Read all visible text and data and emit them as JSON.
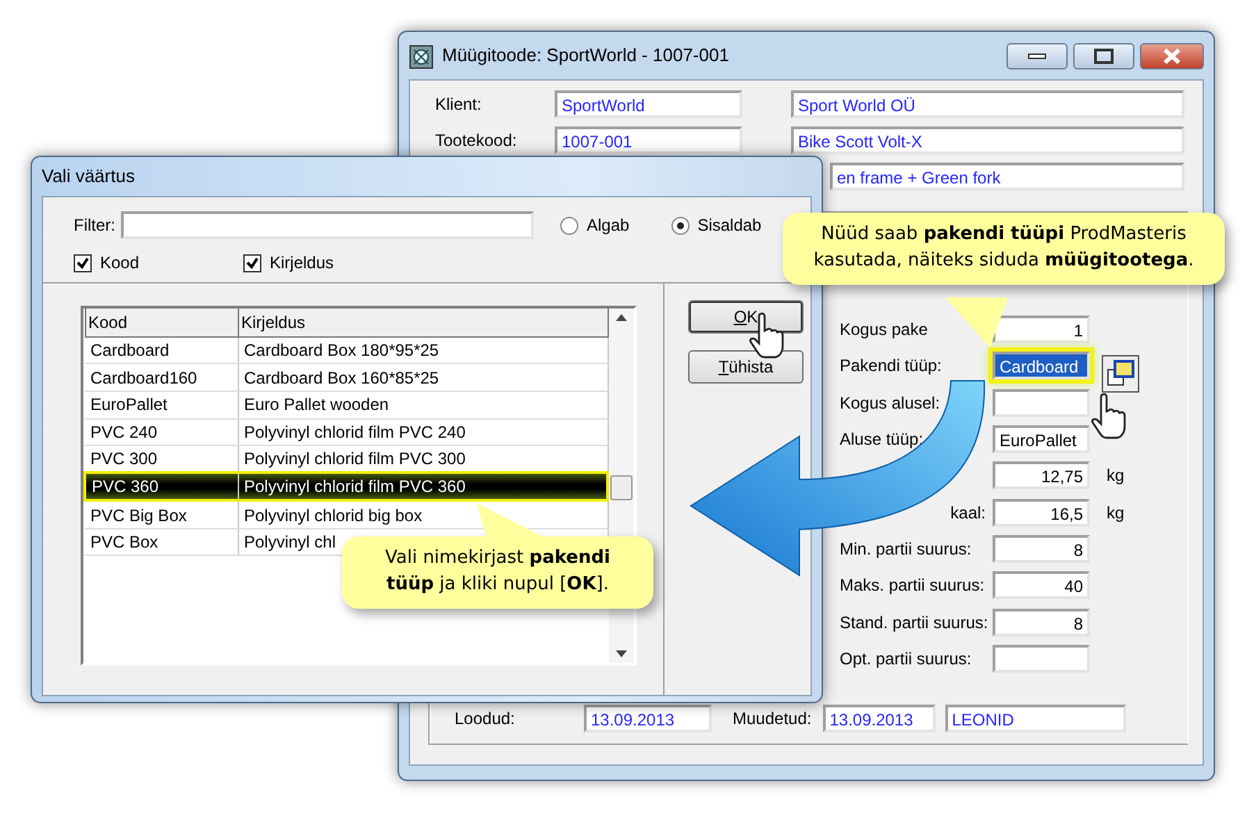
{
  "main_window": {
    "title": "Müügitoode: SportWorld - 1007-001",
    "header_rows": [
      {
        "label": "Klient:",
        "code": "SportWorld",
        "name": "Sport World OÜ"
      },
      {
        "label": "Tootekood:",
        "code": "1007-001",
        "name": "Bike Scott Volt-X"
      },
      {
        "name": "en frame + Green fork"
      }
    ],
    "fields": [
      {
        "label": "Kogus pake",
        "value": "1",
        "kind": "number"
      },
      {
        "label": "Pakendi tüüp:",
        "value": "Cardboard",
        "kind": "picker",
        "highlighted": true
      },
      {
        "label": "Kogus alusel:",
        "kind": "number"
      },
      {
        "label": "Aluse tüüp:",
        "value": "EuroPallet",
        "kind": "text"
      },
      {
        "value": "12,75",
        "unit": "kg",
        "kind": "number"
      },
      {
        "label": "kaal:",
        "value": "16,5",
        "unit": "kg",
        "kind": "number"
      },
      {
        "label": "Min. partii suurus:",
        "value": "8",
        "kind": "number"
      },
      {
        "label": "Maks. partii suurus:",
        "value": "40",
        "kind": "number"
      },
      {
        "label": "Stand. partii suurus:",
        "value": "8",
        "kind": "number"
      },
      {
        "label": "Opt. partii suurus:",
        "kind": "number"
      }
    ],
    "footer": {
      "created_label": "Loodud:",
      "created": "13.09.2013",
      "modified_label": "Muudetud:",
      "modified": "13.09.2013",
      "user": "LEONID"
    }
  },
  "dialog": {
    "title": "Vali väärtus",
    "filter": {
      "label": "Filter:"
    },
    "match_modes": [
      {
        "label": "Algab",
        "selected": false
      },
      {
        "label": "Sisaldab",
        "selected": true
      }
    ],
    "search_in": [
      {
        "label": "Kood",
        "checked": true
      },
      {
        "label": "Kirjeldus",
        "checked": true
      }
    ],
    "table": {
      "columns": [
        "Kood",
        "Kirjeldus"
      ],
      "rows": [
        {
          "cells": [
            "Cardboard",
            "Cardboard Box 180*95*25"
          ],
          "selected": false
        },
        {
          "cells": [
            "Cardboard160",
            "Cardboard Box 160*85*25"
          ],
          "selected": false
        },
        {
          "cells": [
            "EuroPallet",
            "Euro Pallet wooden"
          ],
          "selected": false
        },
        {
          "cells": [
            "PVC 240",
            "Polyvinyl chlorid film PVC 240"
          ],
          "selected": false
        },
        {
          "cells": [
            "PVC 300",
            "Polyvinyl chlorid film PVC 300"
          ],
          "selected": false
        },
        {
          "cells": [
            "PVC 360",
            "Polyvinyl chlorid film PVC 360"
          ],
          "selected": true
        },
        {
          "cells": [
            "PVC Big Box",
            "Polyvinyl chlorid big box"
          ],
          "selected": false
        },
        {
          "cells": [
            "PVC Box",
            "Polyvinyl chl"
          ],
          "selected": false
        }
      ]
    },
    "buttons": [
      {
        "label": "OK"
      },
      {
        "label": "Tühista"
      }
    ]
  },
  "callouts": [
    {
      "text": "Nüüd saab **pakendi tüüpi** ProdMasteris kasutada, näiteks siduda **müügitootega**."
    },
    {
      "text": "Vali nimekirjast **pakendi tüüp** ja kliki nupul [**OK**]."
    }
  ]
}
